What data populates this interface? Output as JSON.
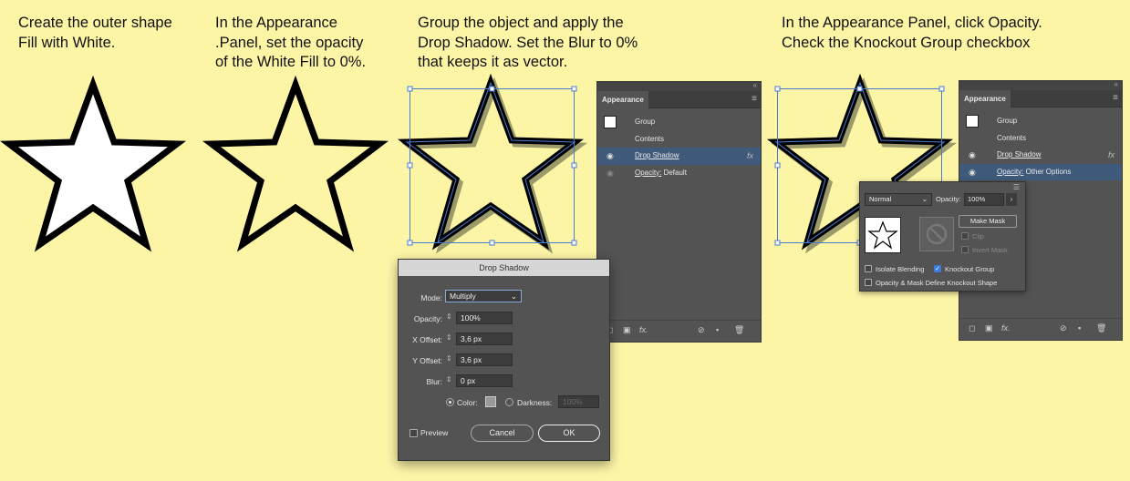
{
  "captions": [
    {
      "lines": [
        "Create the outer shape",
        "Fill with White."
      ]
    },
    {
      "lines": [
        "In the Appearance",
        ".Panel, set the opacity",
        "of the White Fill to 0%."
      ]
    },
    {
      "lines": [
        "Group the object and apply the",
        "Drop Shadow. Set the Blur to 0%",
        "that keeps it as vector."
      ]
    },
    {
      "lines": [
        "In the Appearance Panel, click Opacity.",
        "Check the Knockout Group checkbox"
      ]
    }
  ],
  "colors": {
    "background": "#fdf5a6",
    "panel": "#535353",
    "selection": "#3f5a7a",
    "bbox": "#4a7bd0",
    "shadow": "#9a9a6a"
  },
  "panel1": {
    "tab": "Appearance",
    "rows": [
      {
        "label": "Group"
      },
      {
        "label": "Contents"
      },
      {
        "label": "Drop Shadow",
        "fx": "fx"
      },
      {
        "label_prefix": "Opacity:",
        "label_suffix": " Default"
      }
    ]
  },
  "panel2": {
    "tab": "Appearance",
    "rows": [
      {
        "label": "Group"
      },
      {
        "label": "Contents"
      },
      {
        "label": "Drop Shadow",
        "fx": "fx"
      },
      {
        "label_prefix": "Opacity:",
        "label_suffix": " Other Options"
      }
    ]
  },
  "dialog": {
    "title": "Drop Shadow",
    "mode_label": "Mode:",
    "mode_value": "Multiply",
    "opacity_label": "Opacity:",
    "opacity_value": "100%",
    "xoffset_label": "X Offset:",
    "xoffset_value": "3,6 px",
    "yoffset_label": "Y Offset:",
    "yoffset_value": "3,6 px",
    "blur_label": "Blur:",
    "blur_value": "0 px",
    "color_label": "Color:",
    "darkness_label": "Darkness:",
    "darkness_value": "100%",
    "preview_label": "Preview",
    "cancel_label": "Cancel",
    "ok_label": "OK"
  },
  "popup": {
    "blend_mode": "Normal",
    "opacity_label": "Opacity:",
    "opacity_value": "100%",
    "make_mask": "Make Mask",
    "clip": "Clip",
    "invert_mask": "Invert Mask",
    "isolate_blending": "Isolate Blending",
    "knockout_group": "Knockout Group",
    "knockout_checked": true,
    "define_knockout": "Opacity & Mask Define Knockout Shape"
  }
}
